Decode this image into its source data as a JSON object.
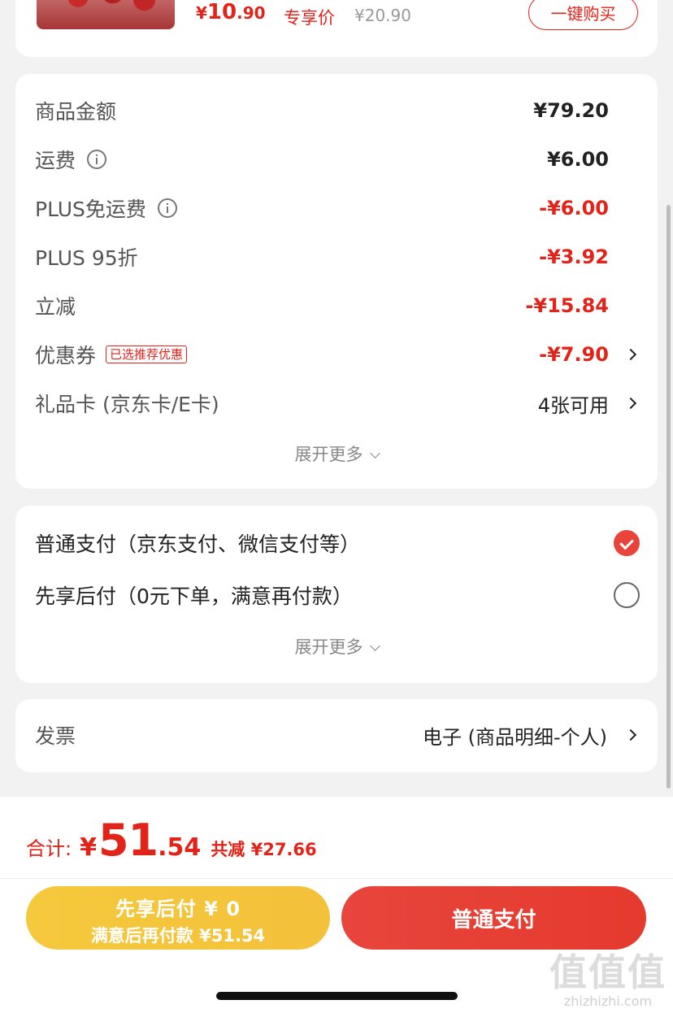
{
  "product": {
    "thumb_label": "",
    "price_currency": "¥",
    "price_int": "10",
    "price_dec": ".90",
    "price_tag": "专享价",
    "price_old": "¥20.90",
    "buy_label": "一键购买"
  },
  "amounts": {
    "rows": [
      {
        "label": "商品金额",
        "value": "¥79.20"
      },
      {
        "label": "运费",
        "value": "¥6.00"
      },
      {
        "label": "PLUS免运费",
        "value": "-¥6.00"
      },
      {
        "label": "PLUS 95折",
        "value": "-¥3.92"
      },
      {
        "label": "立减",
        "value": "-¥15.84"
      },
      {
        "label": "优惠券",
        "badge": "已选推荐优惠",
        "value": "-¥7.90"
      },
      {
        "label": "礼品卡 (京东卡/E卡)",
        "value": "4张可用"
      }
    ],
    "expand_label": "展开更多"
  },
  "payment": {
    "options": [
      {
        "label": "普通支付（京东支付、微信支付等）",
        "selected": true
      },
      {
        "label": "先享后付（0元下单，满意再付款）",
        "selected": false
      }
    ],
    "expand_label": "展开更多"
  },
  "invoice": {
    "label": "发票",
    "value": "电子 (商品明细-个人)"
  },
  "summary": {
    "total_label": "合计:",
    "currency": "¥",
    "total_int": "51",
    "total_dec": ".54",
    "savings": "共减 ¥27.66"
  },
  "actions": {
    "pay_later_line1": "先享后付 ¥ 0",
    "pay_later_line2": "满意后再付款 ¥51.54",
    "pay_normal": "普通支付"
  },
  "watermark": {
    "logo": "值值值",
    "url": "zhizhizhi.com"
  },
  "colors": {
    "accent": "#e2231a",
    "pay_later": "#f5c93d",
    "pay_normal": "#e8453c"
  }
}
